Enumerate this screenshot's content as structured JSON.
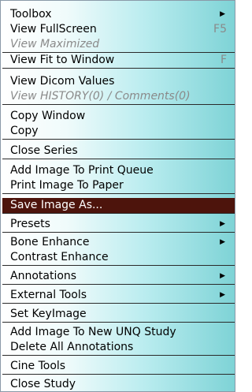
{
  "menu": {
    "groups": [
      [
        {
          "label": "Toolbox",
          "arrow": true
        },
        {
          "label": "View FullScreen",
          "shortcut": "F5"
        },
        {
          "label": "View Maximized",
          "disabled": true
        }
      ],
      [
        {
          "label": "View Fit to Window",
          "shortcut": "F"
        }
      ],
      [
        {
          "label": "View Dicom Values"
        },
        {
          "label": "View HISTORY(0) / Comments(0)",
          "disabled": true
        }
      ],
      [
        {
          "label": "Copy Window"
        },
        {
          "label": "Copy"
        }
      ],
      [
        {
          "label": "Close Series"
        }
      ],
      [
        {
          "label": "Add Image To Print Queue"
        },
        {
          "label": "Print Image To Paper"
        }
      ],
      [
        {
          "label": "Save Image As...",
          "selected": true
        }
      ],
      [
        {
          "label": "Presets",
          "arrow": true
        }
      ],
      [
        {
          "label": "Bone Enhance",
          "arrow": true
        },
        {
          "label": "Contrast Enhance"
        }
      ],
      [
        {
          "label": "Annotations",
          "arrow": true
        }
      ],
      [
        {
          "label": "External Tools",
          "arrow": true
        }
      ],
      [
        {
          "label": "Set KeyImage"
        }
      ],
      [
        {
          "label": "Add Image To New UNQ Study"
        },
        {
          "label": "Delete All Annotations"
        }
      ],
      [
        {
          "label": "Cine Tools"
        }
      ],
      [
        {
          "label": "Close Study"
        }
      ]
    ],
    "icons": {
      "submenu": "submenu-arrow-icon",
      "arrow_glyph": "▶"
    },
    "colors": {
      "selected_bg": "#4d140c",
      "selected_fg": "#ffffff",
      "disabled_fg": "#8a8a8a",
      "separator": "#2a2a2a"
    }
  }
}
